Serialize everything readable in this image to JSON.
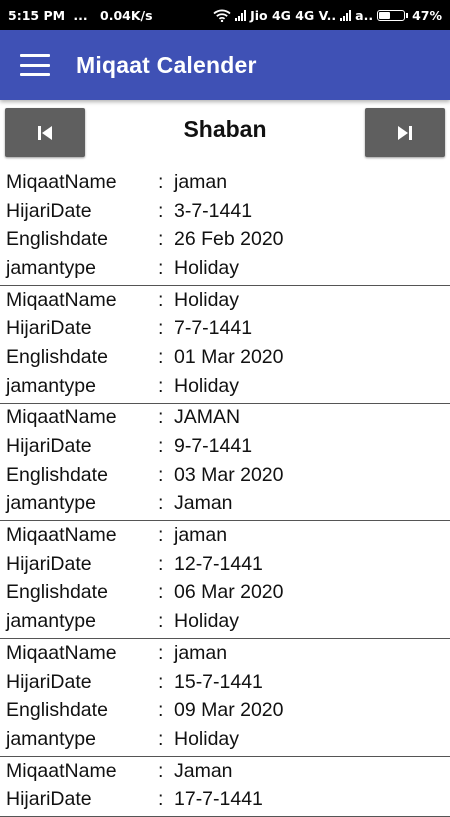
{
  "status_bar": {
    "time": "5:15 PM",
    "dots": "...",
    "net_speed": "0.04K/s",
    "carrier": "Jio 4G 4G V..",
    "carrier2": "a..",
    "battery": "47%",
    "battery_level": 0.47
  },
  "app_bar": {
    "title": "Miqaat Calender",
    "menu_icon": "hamburger-menu-icon"
  },
  "month_nav": {
    "month": "Shaban",
    "prev_icon": "skip-previous-icon",
    "next_icon": "skip-next-icon"
  },
  "colon": ":",
  "records": [
    {
      "fields": [
        {
          "label": "MiqaatName",
          "value": "jaman"
        },
        {
          "label": "HijariDate",
          "value": "3-7-1441"
        },
        {
          "label": "Englishdate",
          "value": "26 Feb 2020"
        },
        {
          "label": "jamantype",
          "value": "Holiday"
        }
      ]
    },
    {
      "fields": [
        {
          "label": "MiqaatName",
          "value": "Holiday"
        },
        {
          "label": "HijariDate",
          "value": "7-7-1441"
        },
        {
          "label": "Englishdate",
          "value": "01 Mar 2020"
        },
        {
          "label": "jamantype",
          "value": "Holiday"
        }
      ]
    },
    {
      "fields": [
        {
          "label": "MiqaatName",
          "value": "JAMAN"
        },
        {
          "label": "HijariDate",
          "value": "9-7-1441"
        },
        {
          "label": "Englishdate",
          "value": "03 Mar 2020"
        },
        {
          "label": "jamantype",
          "value": "Jaman"
        }
      ]
    },
    {
      "fields": [
        {
          "label": "MiqaatName",
          "value": "jaman"
        },
        {
          "label": "HijariDate",
          "value": "12-7-1441"
        },
        {
          "label": "Englishdate",
          "value": "06 Mar 2020"
        },
        {
          "label": "jamantype",
          "value": "Holiday"
        }
      ]
    },
    {
      "fields": [
        {
          "label": "MiqaatName",
          "value": "jaman"
        },
        {
          "label": "HijariDate",
          "value": "15-7-1441"
        },
        {
          "label": "Englishdate",
          "value": "09 Mar 2020"
        },
        {
          "label": "jamantype",
          "value": "Holiday"
        }
      ]
    },
    {
      "fields": [
        {
          "label": "MiqaatName",
          "value": "Jaman"
        },
        {
          "label": "HijariDate",
          "value": "17-7-1441"
        }
      ]
    }
  ]
}
